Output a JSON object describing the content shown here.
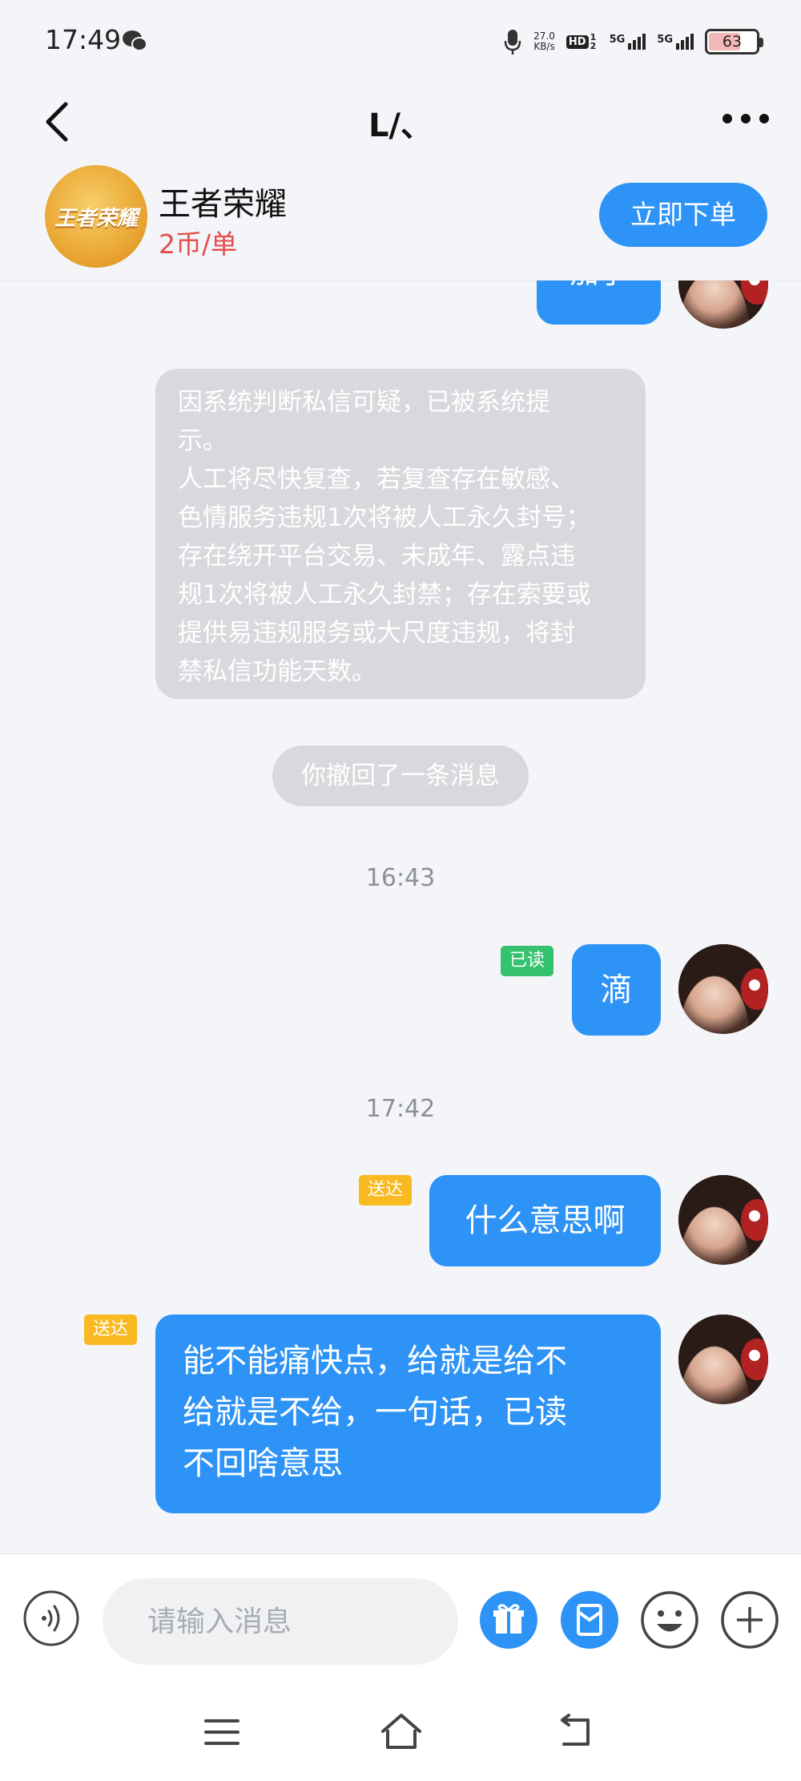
{
  "status_bar": {
    "time": "17:49",
    "net_speed_value": "27.0",
    "net_speed_unit": "KB/s",
    "hd_label": "HD",
    "hd_sub": "1 2",
    "sig1_label": "5G",
    "sig2_label": "5G",
    "battery": "63",
    "battery_level": 0.63
  },
  "nav": {
    "title": "L/、"
  },
  "game": {
    "name": "王者荣耀",
    "price": "2币/单",
    "logo_text": "王者荣耀",
    "order_label": "立即下单"
  },
  "messages": {
    "partial_text": "加了",
    "system_notice": "因系统判断私信可疑，已被系统提\n示。\n人工将尽快复查，若复查存在敏感、\n色情服务违规1次将被人工永久封号；\n存在绕开平台交易、未成年、露点违\n规1次将被人工永久封禁；存在索要或\n提供易违规服务或大尺度违规，将封\n禁私信功能天数。",
    "recall_notice": "你撤回了一条消息",
    "time_1": "16:43",
    "read_badge": "已读",
    "msg_1": "滴",
    "time_2": "17:42",
    "sent_badge_2": "送达",
    "msg_2": "什么意思啊",
    "sent_badge_3": "送达",
    "msg_3": "能不能痛快点，给就是给不\n给就是不给，一句话，已读\n不回啥意思"
  },
  "input": {
    "placeholder": "请输入消息"
  },
  "colors": {
    "accent": "#2e93f6",
    "price": "#e54d4d",
    "read": "#35c26e",
    "sent": "#f8b921"
  }
}
